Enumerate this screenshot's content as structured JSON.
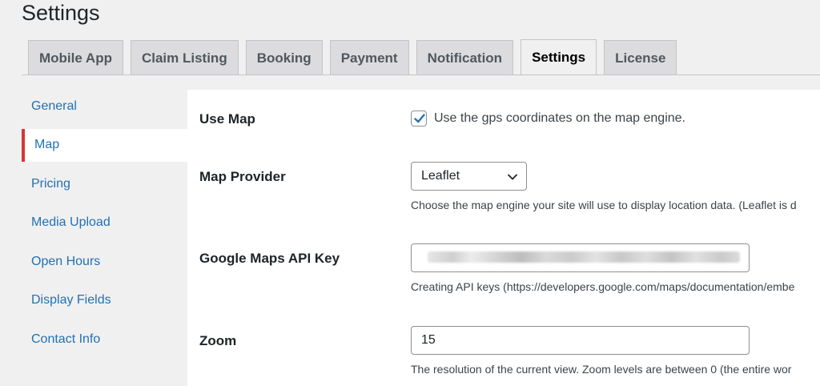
{
  "page": {
    "title": "Settings"
  },
  "tabs": [
    {
      "label": "Mobile App",
      "active": false
    },
    {
      "label": "Claim Listing",
      "active": false
    },
    {
      "label": "Booking",
      "active": false
    },
    {
      "label": "Payment",
      "active": false
    },
    {
      "label": "Notification",
      "active": false
    },
    {
      "label": "Settings",
      "active": true
    },
    {
      "label": "License",
      "active": false
    }
  ],
  "sidebar": {
    "items": [
      {
        "label": "General",
        "active": false
      },
      {
        "label": "Map",
        "active": true
      },
      {
        "label": "Pricing",
        "active": false
      },
      {
        "label": "Media Upload",
        "active": false
      },
      {
        "label": "Open Hours",
        "active": false
      },
      {
        "label": "Display Fields",
        "active": false
      },
      {
        "label": "Contact Info",
        "active": false
      }
    ]
  },
  "fields": {
    "use_map": {
      "label": "Use Map",
      "checked": true,
      "checkbox_text": "Use the gps coordinates on the map engine."
    },
    "map_provider": {
      "label": "Map Provider",
      "selected": "Leaflet",
      "description": "Choose the map engine your site will use to display location data. (Leaflet is d"
    },
    "google_api_key": {
      "label": "Google Maps API Key",
      "value_redacted": true,
      "description": "Creating API keys (https://developers.google.com/maps/documentation/embe"
    },
    "zoom": {
      "label": "Zoom",
      "value": "15",
      "description": "The resolution of the current view. Zoom levels are between 0 (the entire wor"
    }
  },
  "colors": {
    "accent": "#2271b1",
    "active_marker": "#d63638",
    "background": "#f0f0f1",
    "tab_inactive": "#dcdcde"
  }
}
